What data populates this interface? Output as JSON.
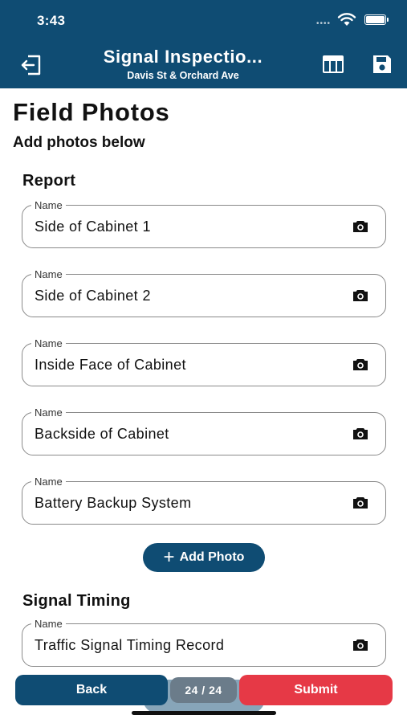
{
  "status_bar": {
    "time": "3:43",
    "dots": "••••"
  },
  "header": {
    "title": "Signal Inspectio...",
    "subtitle": "Davis St & Orchard Ave",
    "left_icon": "exit-icon",
    "right_icons": [
      "table-icon",
      "save-icon"
    ]
  },
  "page": {
    "title": "Field Photos",
    "subtitle": "Add photos below"
  },
  "sections": [
    {
      "title": "Report",
      "fields": [
        {
          "label": "Name",
          "value": "Side of Cabinet 1",
          "icon": "camera-icon"
        },
        {
          "label": "Name",
          "value": "Side of Cabinet 2",
          "icon": "camera-icon"
        },
        {
          "label": "Name",
          "value": "Inside Face of Cabinet",
          "icon": "camera-icon"
        },
        {
          "label": "Name",
          "value": "Backside of Cabinet",
          "icon": "camera-icon"
        },
        {
          "label": "Name",
          "value": "Battery Backup System",
          "icon": "camera-icon"
        }
      ],
      "add_button": "Add Photo"
    },
    {
      "title": "Signal Timing",
      "fields": [
        {
          "label": "Name",
          "value": "Traffic Signal Timing Record",
          "icon": "camera-icon"
        }
      ]
    }
  ],
  "footer": {
    "back": "Back",
    "pager": "24 / 24",
    "submit": "Submit"
  },
  "colors": {
    "primary": "#0f4c73",
    "submit": "#e63946",
    "pager": "#6b7c8a"
  }
}
